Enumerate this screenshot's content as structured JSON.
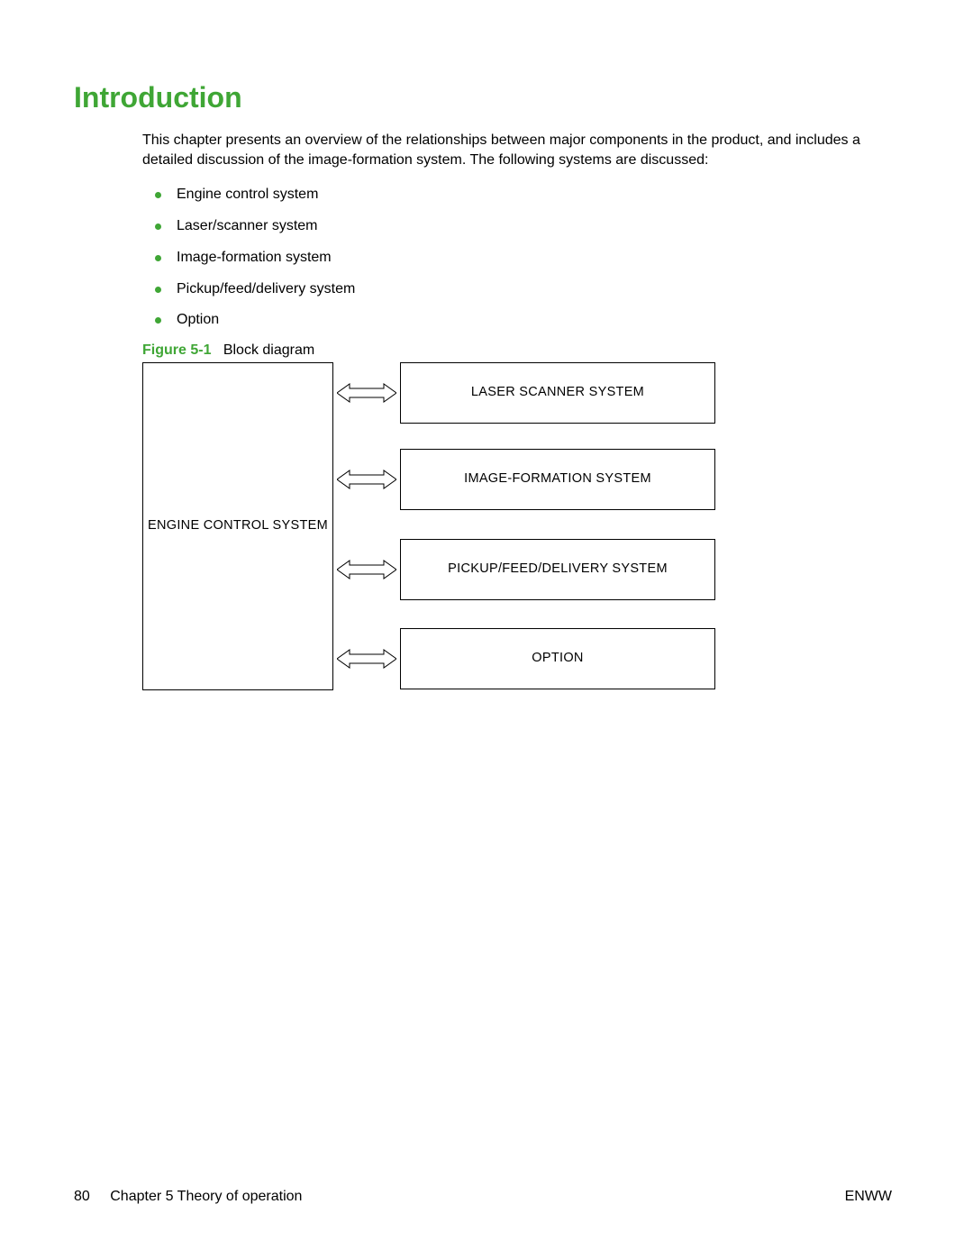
{
  "heading": "Introduction",
  "intro": "This chapter presents an overview of the relationships between major components in the product, and includes a detailed discussion of the image-formation system. The following systems are discussed:",
  "bullets": [
    "Engine control system",
    "Laser/scanner system",
    "Image-formation system",
    "Pickup/feed/delivery system",
    "Option"
  ],
  "figure": {
    "label": "Figure 5-1",
    "caption": "Block diagram",
    "engine_box": "ENGINE CONTROL SYSTEM",
    "right_boxes": [
      "LASER SCANNER SYSTEM",
      "IMAGE-FORMATION SYSTEM",
      "PICKUP/FEED/DELIVERY SYSTEM",
      "OPTION"
    ]
  },
  "footer": {
    "page_number": "80",
    "chapter": "Chapter 5   Theory of operation",
    "lang": "ENWW"
  }
}
